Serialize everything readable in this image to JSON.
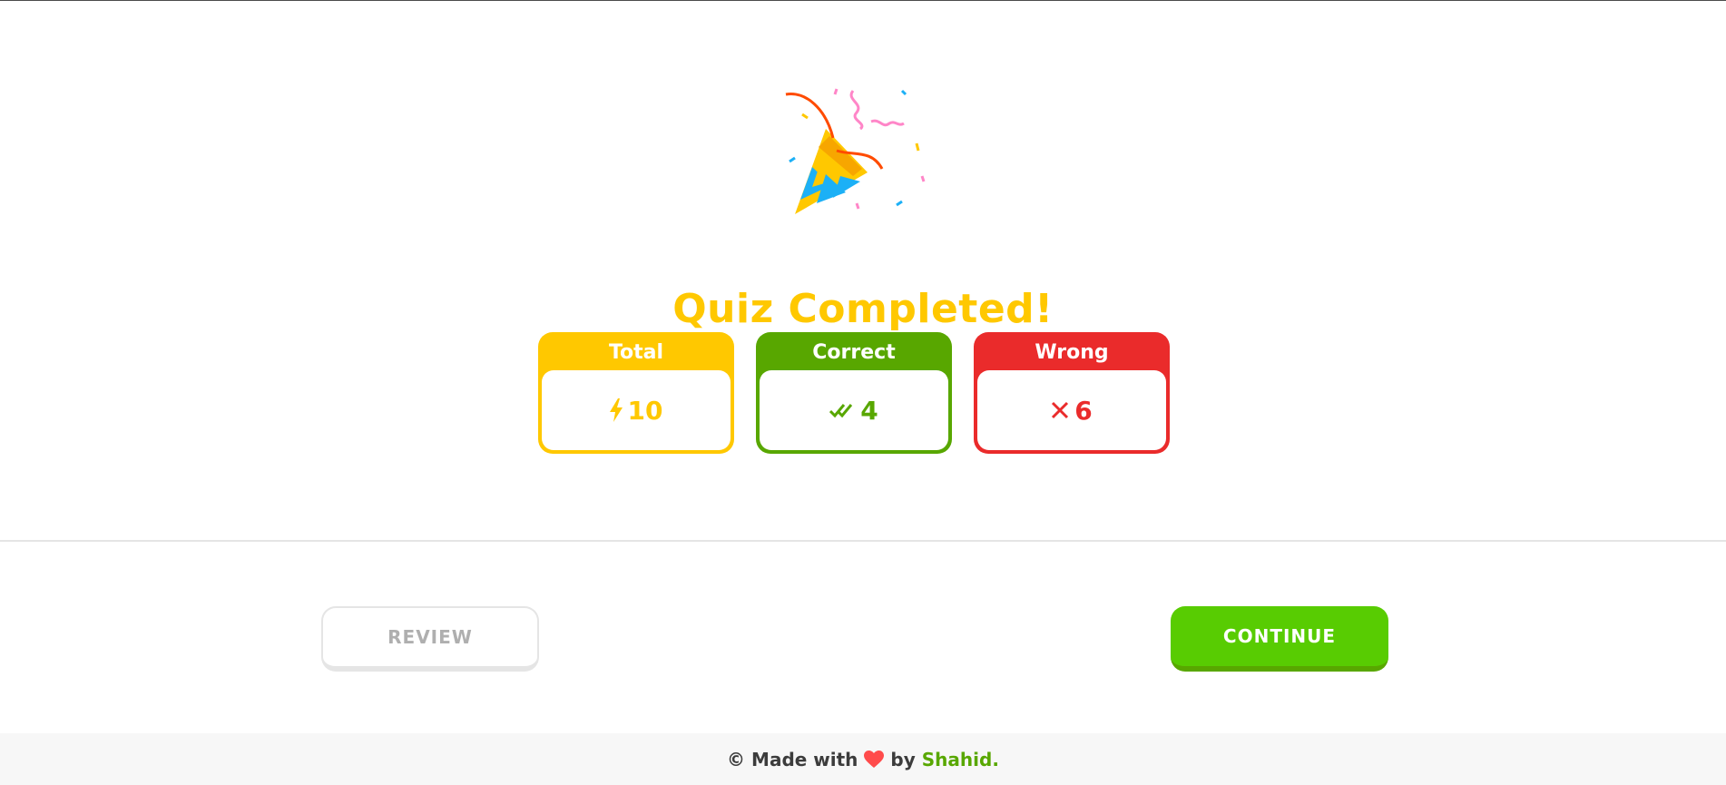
{
  "hero": {
    "icon": "party-popper-icon",
    "title": "Quiz Completed!"
  },
  "stats": [
    {
      "label": "Total",
      "value": "10",
      "icon": "lightning-icon",
      "color": "#ffc800"
    },
    {
      "label": "Correct",
      "value": "4",
      "icon": "double-check-icon",
      "color": "#58a700"
    },
    {
      "label": "Wrong",
      "value": "6",
      "icon": "x-icon",
      "color": "#ea2b2b"
    }
  ],
  "actions": {
    "review_label": "REVIEW",
    "continue_label": "CONTINUE"
  },
  "footer": {
    "copyright": "©",
    "made_with": "Made with",
    "heart_icon": "heart-icon",
    "by": "by",
    "author": "Shahid",
    "period": "."
  },
  "colors": {
    "accent_yellow": "#ffc800",
    "accent_green": "#58cc02",
    "dark_green": "#58a700",
    "red": "#ea2b2b"
  }
}
